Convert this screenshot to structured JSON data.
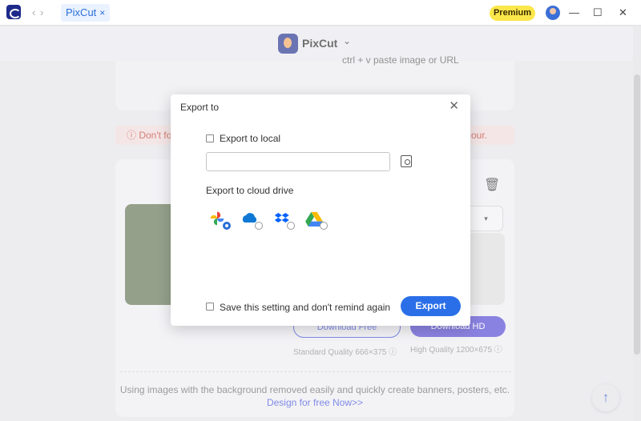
{
  "titlebar": {
    "tab_label": "PixCut",
    "tab_close": "×",
    "premium_label": "Premium",
    "back_arrow": "‹",
    "forward_arrow": "›",
    "minimize": "—",
    "maximize": "☐",
    "close": "✕"
  },
  "app_header": {
    "brand": "PixCut",
    "chevron": "⌄"
  },
  "background_page": {
    "paste_hint": "ctrl + v paste image or URL",
    "warning_left": "ⓘ Don't fo",
    "warning_right": "hour.",
    "download_free": "Download Free",
    "download_hd": "Download HD",
    "standard_quality": "Standard Quality 666×375 ⓘ",
    "high_quality": "High Quality 1200×675 ⓘ",
    "promo_text": "Using images with the background removed easily and quickly create banners, posters, etc.",
    "promo_link": "Design for free Now>>"
  },
  "dialog": {
    "title": "Export to",
    "export_local_label": "Export to local",
    "export_local_checked": false,
    "path_value": "",
    "export_cloud_label": "Export to cloud drive",
    "cloud_drives": [
      {
        "name": "google-photos",
        "selected": true
      },
      {
        "name": "onedrive",
        "selected": false
      },
      {
        "name": "dropbox",
        "selected": false
      },
      {
        "name": "google-drive",
        "selected": false
      }
    ],
    "remember_label": "Save this setting and don't remind again",
    "remember_checked": false,
    "export_button": "Export"
  },
  "colors": {
    "accent": "#2b6fe8",
    "premium": "#fbe74a",
    "warning_text": "#c0392b"
  }
}
